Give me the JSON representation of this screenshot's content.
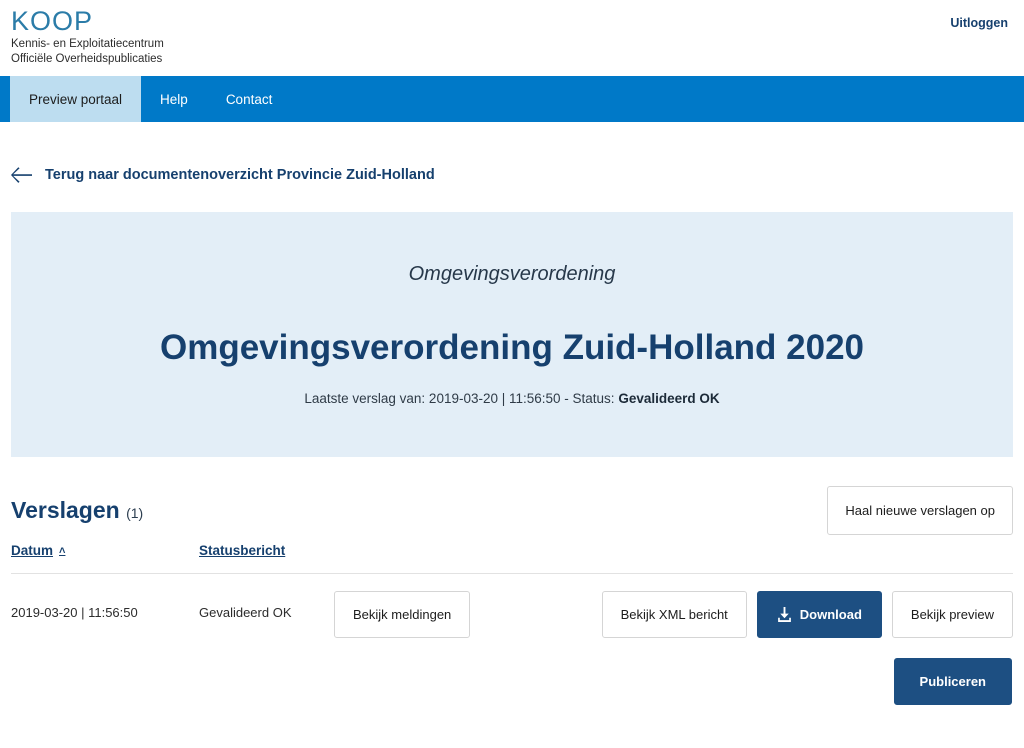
{
  "header": {
    "logo_title": "KOOP",
    "logo_subtitle_line1": "Kennis- en Exploitatiecentrum",
    "logo_subtitle_line2": "Officiële Overheidspublicaties",
    "logout_label": "Uitloggen"
  },
  "nav": {
    "items": [
      {
        "label": "Preview portaal",
        "active": true
      },
      {
        "label": "Help",
        "active": false
      },
      {
        "label": "Contact",
        "active": false
      }
    ]
  },
  "back_link": {
    "icon": "arrow-left-icon",
    "label": "Terug naar documentenoverzicht Provincie Zuid-Holland"
  },
  "hero": {
    "eyebrow": "Omgevingsverordening",
    "title": "Omgevingsverordening Zuid-Holland 2020",
    "meta_prefix": "Laatste verslag van: 2019-03-20 | 11:56:50 - Status: ",
    "meta_status": "Gevalideerd OK"
  },
  "reports": {
    "title": "Verslagen",
    "count": "(1)",
    "refresh_label": "Haal nieuwe verslagen op",
    "columns": {
      "date": "Datum",
      "status": "Statusbericht",
      "sort_caret": "˄"
    },
    "rows": [
      {
        "date": "2019-03-20 | 11:56:50",
        "status": "Gevalideerd OK",
        "buttons": {
          "messages": "Bekijk meldingen",
          "xml": "Bekijk XML bericht",
          "download": "Download",
          "download_icon": "download-icon",
          "preview": "Bekijk preview",
          "publish": "Publiceren"
        }
      }
    ]
  },
  "colors": {
    "nav_blue": "#0079c8",
    "active_tab": "#bdddf0",
    "navy": "#16406e",
    "primary_button": "#1d4f82",
    "hero_bg": "#e3eef7",
    "logo_blue": "#2b7ca8"
  }
}
